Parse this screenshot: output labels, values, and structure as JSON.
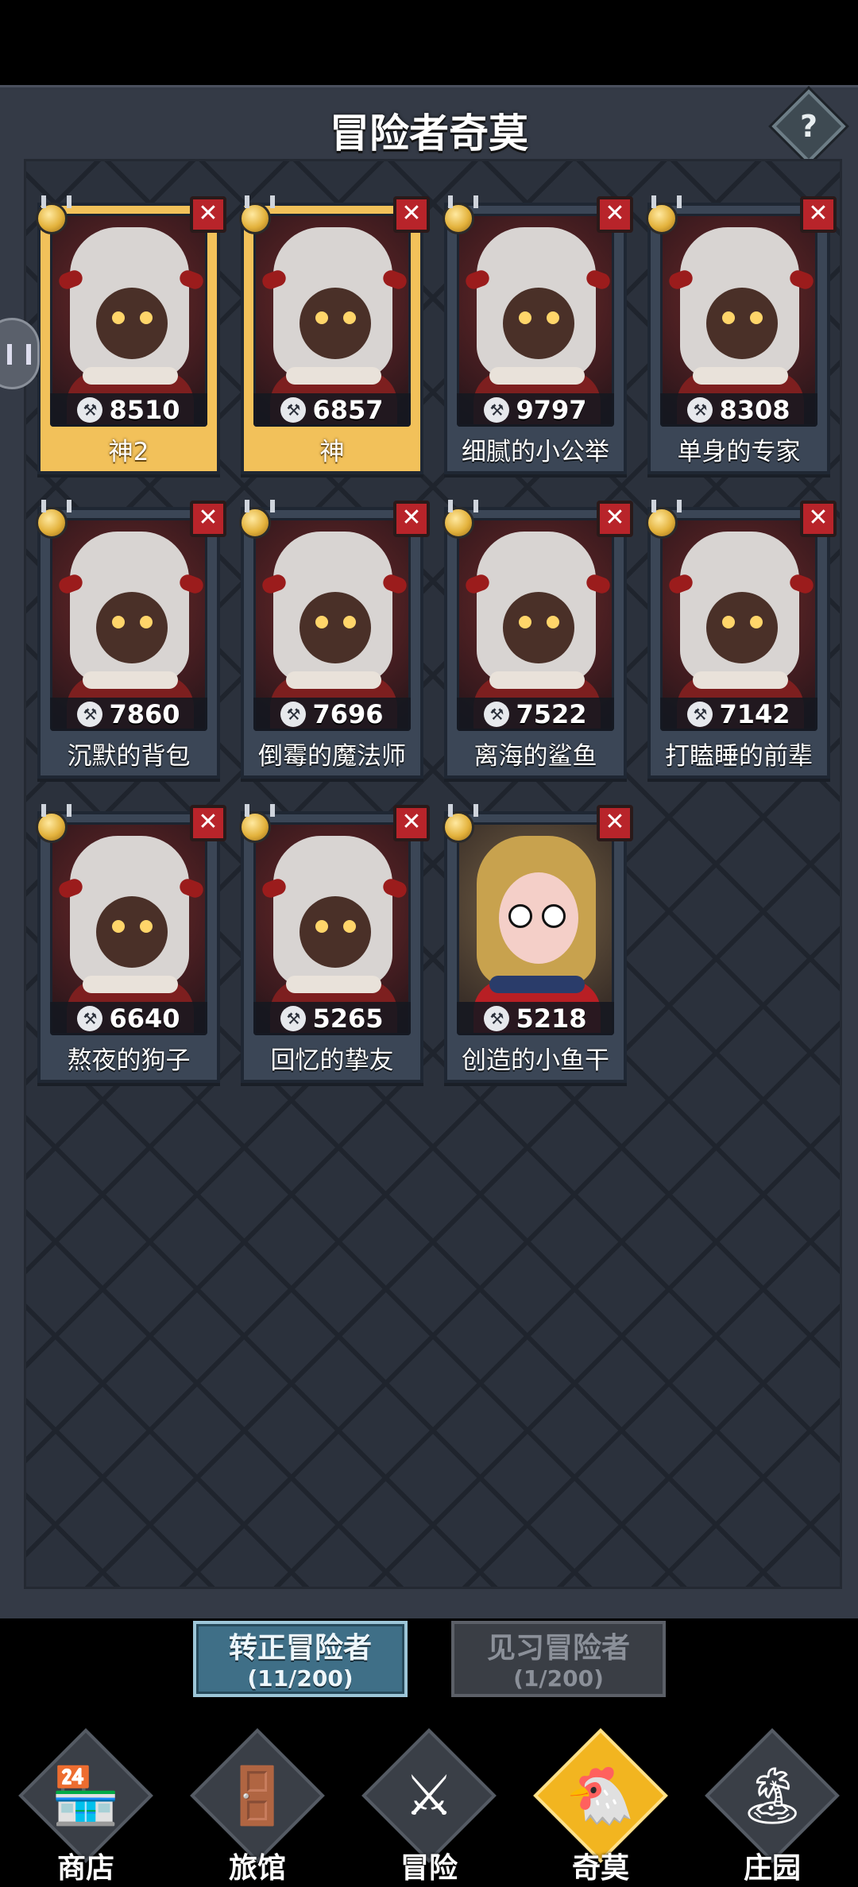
{
  "header": {
    "title": "冒险者奇莫",
    "help_label": "?"
  },
  "adventurers": [
    {
      "name": "神2",
      "power": "8510",
      "selected": true,
      "skin": "horned"
    },
    {
      "name": "神",
      "power": "6857",
      "selected": true,
      "skin": "horned"
    },
    {
      "name": "细腻的小公举",
      "power": "9797",
      "selected": false,
      "skin": "horned"
    },
    {
      "name": "单身的专家",
      "power": "8308",
      "selected": false,
      "skin": "horned"
    },
    {
      "name": "沉默的背包",
      "power": "7860",
      "selected": false,
      "skin": "horned"
    },
    {
      "name": "倒霉的魔法师",
      "power": "7696",
      "selected": false,
      "skin": "horned"
    },
    {
      "name": "离海的鲨鱼",
      "power": "7522",
      "selected": false,
      "skin": "horned"
    },
    {
      "name": "打瞌睡的前辈",
      "power": "7142",
      "selected": false,
      "skin": "horned"
    },
    {
      "name": "熬夜的狗子",
      "power": "6640",
      "selected": false,
      "skin": "horned"
    },
    {
      "name": "回忆的挚友",
      "power": "5265",
      "selected": false,
      "skin": "horned"
    },
    {
      "name": "创造的小鱼干",
      "power": "5218",
      "selected": false,
      "skin": "blonde"
    }
  ],
  "tabs": [
    {
      "label": "转正冒险者",
      "count": "(11/200)",
      "active": true
    },
    {
      "label": "见习冒险者",
      "count": "(1/200)",
      "active": false
    }
  ],
  "nav": [
    {
      "label": "商店",
      "icon": "shop-icon",
      "glyph": "🏪",
      "active": false
    },
    {
      "label": "旅馆",
      "icon": "inn-icon",
      "glyph": "🚪",
      "active": false
    },
    {
      "label": "冒险",
      "icon": "swords-icon",
      "glyph": "⚔",
      "active": false
    },
    {
      "label": "奇莫",
      "icon": "chimo-icon",
      "glyph": "🐔",
      "active": true
    },
    {
      "label": "庄园",
      "icon": "manor-icon",
      "glyph": "🏝",
      "active": false
    }
  ],
  "colors": {
    "selected_card": "#f2c15a",
    "card": "#3b4656",
    "close": "#b8242a",
    "active_tab": "#3f6f87"
  }
}
